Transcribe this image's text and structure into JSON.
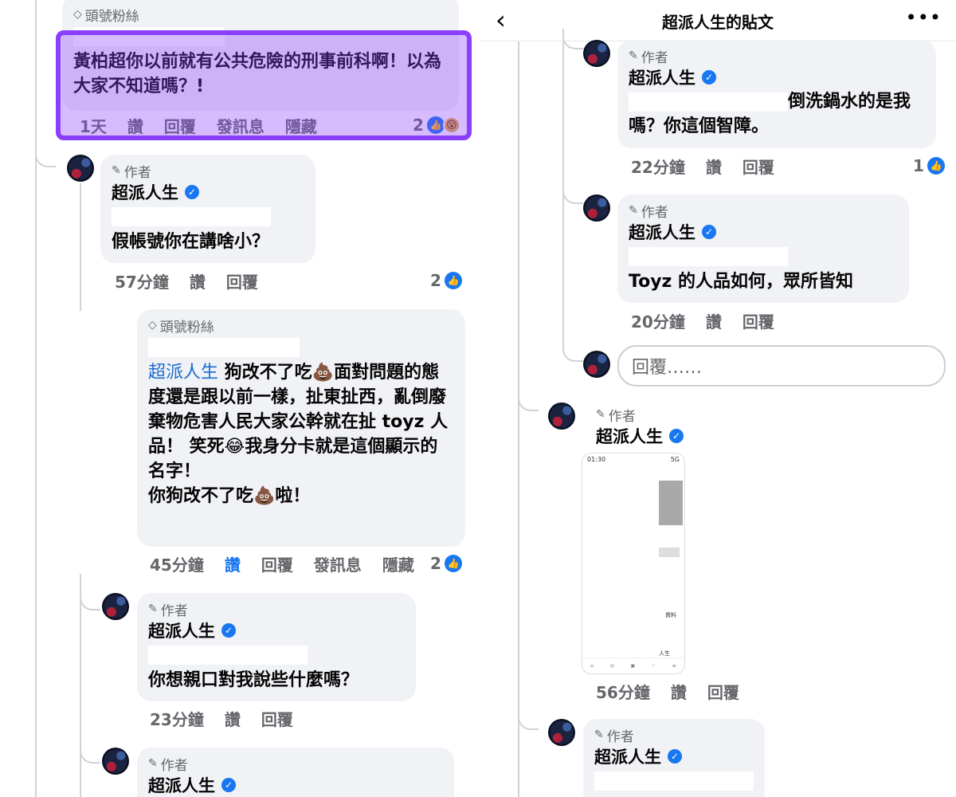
{
  "left": {
    "c1": {
      "badge": "頭號粉絲",
      "text": "黃柏超你以前就有公共危險的刑事前科啊！以為大家不知道嗎？!",
      "time": "1天",
      "like": "讚",
      "reply": "回覆",
      "message": "發訊息",
      "hide": "隱藏",
      "likes": "2"
    },
    "c2": {
      "badge": "作者",
      "name": "超派人生",
      "text": "假帳號你在講啥小？",
      "time": "57分鐘",
      "like": "讚",
      "reply": "回覆",
      "likes": "2"
    },
    "c3": {
      "badge": "頭號粉絲",
      "mention": "超派人生",
      "text_a": " 狗改不了吃💩面對問題的態度還是跟以前一樣，扯東扯西，亂倒廢棄物危害人民大家公幹就在扯 toyz 人品！ 笑死😂我身分卡就是這個顯示的名字！",
      "text_b": "你狗改不了吃💩啦！",
      "time": "45分鐘",
      "like": "讚",
      "reply": "回覆",
      "message": "發訊息",
      "hide": "隱藏",
      "likes": "2"
    },
    "c4": {
      "badge": "作者",
      "name": "超派人生",
      "text": "你想親口對我說些什麼嗎？",
      "time": "23分鐘",
      "like": "讚",
      "reply": "回覆"
    },
    "c5": {
      "badge": "作者",
      "name": "超派人生"
    }
  },
  "right": {
    "header": {
      "title": "超派人生的貼文"
    },
    "r1": {
      "badge": "作者",
      "name": "超派人生",
      "text": "倒洗鍋水的是我嗎？你這個智障。",
      "time": "22分鐘",
      "like": "讚",
      "reply": "回覆",
      "likes": "1"
    },
    "r2": {
      "badge": "作者",
      "name": "超派人生",
      "text": "Toyz 的人品如何，眾所皆知",
      "time": "20分鐘",
      "like": "讚",
      "reply": "回覆"
    },
    "reply_input": {
      "placeholder": "回覆……"
    },
    "r3": {
      "badge": "作者",
      "name": "超派人生",
      "time": "56分鐘",
      "like": "讚",
      "reply": "回覆",
      "phone": {
        "clock": "01:30",
        "signal": "5G",
        "caption": "資料",
        "user": "人生"
      }
    },
    "r4": {
      "badge": "作者",
      "name": "超派人生"
    }
  }
}
